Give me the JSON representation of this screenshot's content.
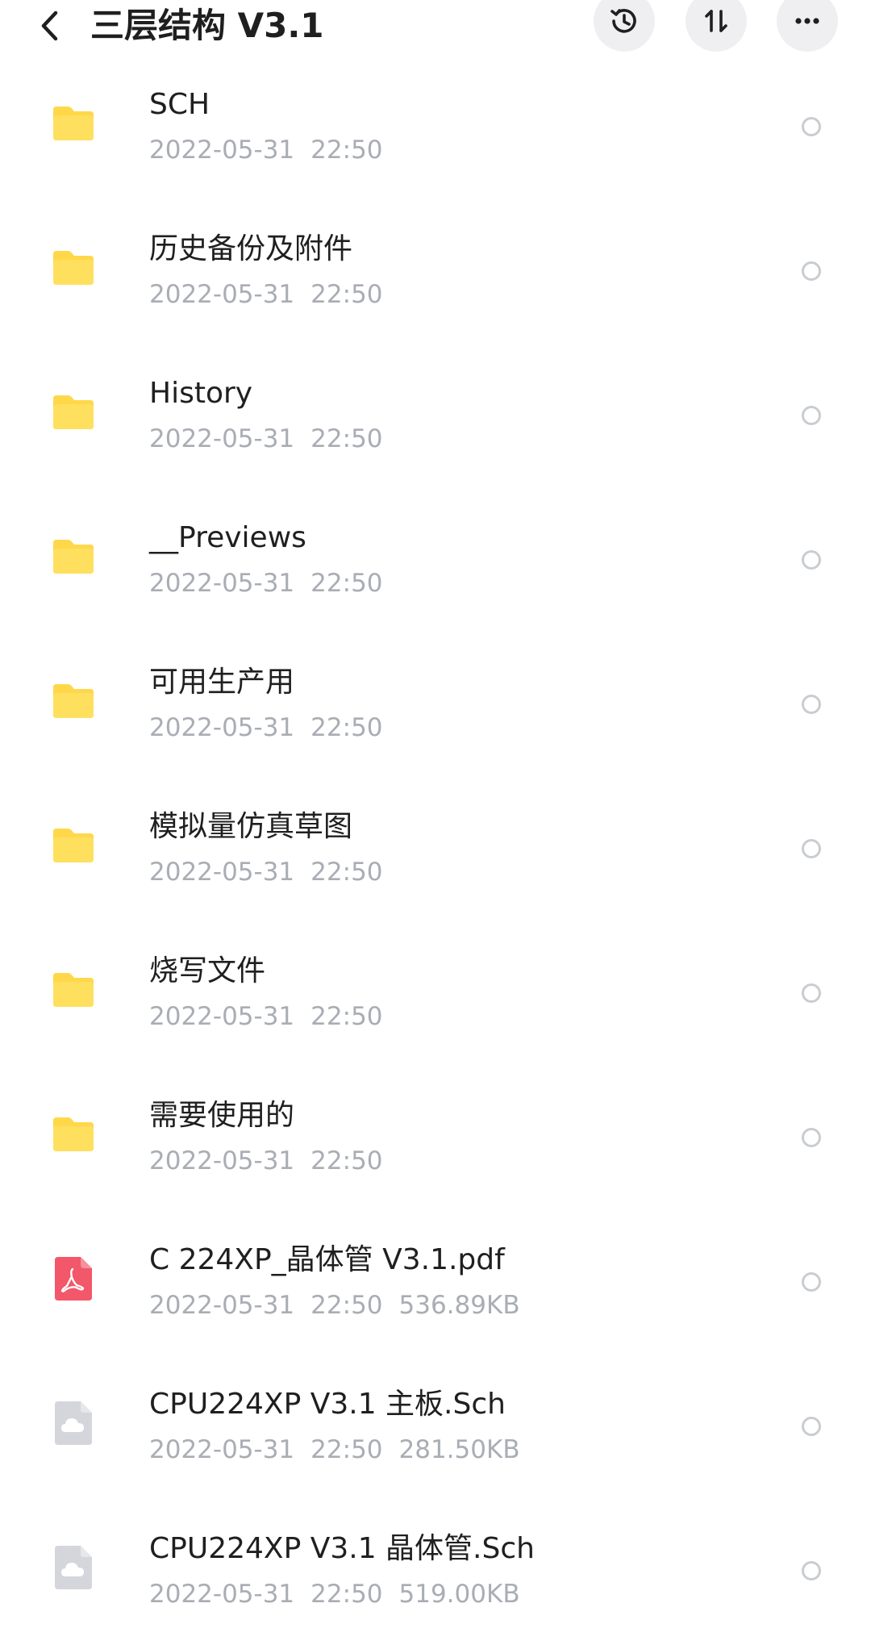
{
  "header": {
    "title": "三层结构 V3.1",
    "back_icon": "chevron-left-icon",
    "history_icon": "history-clock-icon",
    "sort_icon": "sort-arrows-icon",
    "more_icon": "more-horizontal-icon"
  },
  "colors": {
    "folder": "#ffd84a",
    "pdf": "#f2576a",
    "generic_file": "#d4d6db",
    "meta_text": "#a9adb4",
    "header_button_bg": "#efeff1"
  },
  "files": [
    {
      "name": "SCH",
      "date": "2022-05-31",
      "time": "22:50",
      "size": "",
      "type": "folder"
    },
    {
      "name": "历史备份及附件",
      "date": "2022-05-31",
      "time": "22:50",
      "size": "",
      "type": "folder"
    },
    {
      "name": "History",
      "date": "2022-05-31",
      "time": "22:50",
      "size": "",
      "type": "folder"
    },
    {
      "name": "__Previews",
      "date": "2022-05-31",
      "time": "22:50",
      "size": "",
      "type": "folder"
    },
    {
      "name": "可用生产用",
      "date": "2022-05-31",
      "time": "22:50",
      "size": "",
      "type": "folder"
    },
    {
      "name": "模拟量仿真草图",
      "date": "2022-05-31",
      "time": "22:50",
      "size": "",
      "type": "folder"
    },
    {
      "name": "烧写文件",
      "date": "2022-05-31",
      "time": "22:50",
      "size": "",
      "type": "folder"
    },
    {
      "name": "需要使用的",
      "date": "2022-05-31",
      "time": "22:50",
      "size": "",
      "type": "folder"
    },
    {
      "name": "C 224XP_晶体管 V3.1.pdf",
      "date": "2022-05-31",
      "time": "22:50",
      "size": "536.89KB",
      "type": "pdf"
    },
    {
      "name": "CPU224XP V3.1 主板.Sch",
      "date": "2022-05-31",
      "time": "22:50",
      "size": "281.50KB",
      "type": "file"
    },
    {
      "name": "CPU224XP V3.1 晶体管.Sch",
      "date": "2022-05-31",
      "time": "22:50",
      "size": "519.00KB",
      "type": "file"
    }
  ]
}
